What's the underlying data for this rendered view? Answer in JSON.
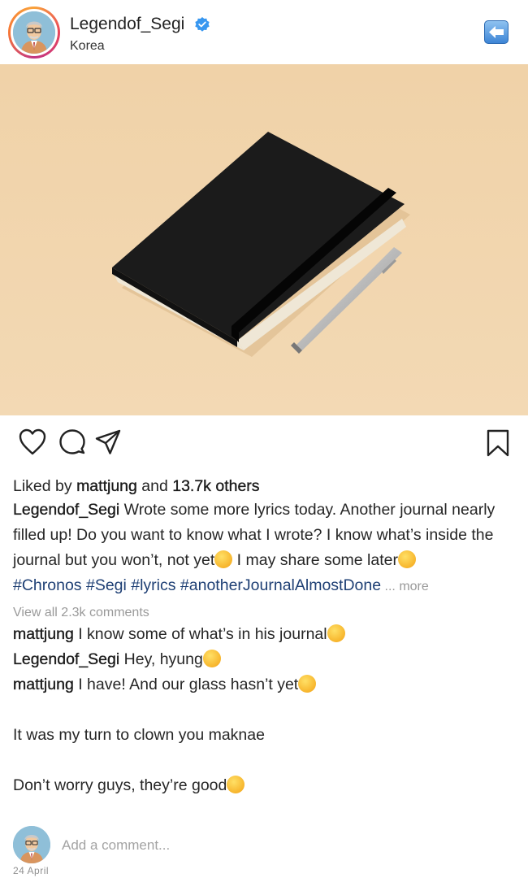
{
  "header": {
    "username": "Legendof_Segi",
    "location": "Korea"
  },
  "post": {
    "liked_prefix": "Liked by ",
    "liked_user": "mattjung",
    "liked_middle": " and ",
    "liked_count": "13.7k others",
    "caption_user": "Legendof_Segi",
    "caption_part1": " Wrote some more lyrics today. Another journal nearly filled up! Do you want to know what I wrote? I know what’s inside the journal but you won’t, not yet",
    "caption_part2": " I may share some later",
    "hashtags": "#Chronos #Segi #lyrics #anotherJournalAlmostDone",
    "more": " ... more",
    "view_all": "View all 2.3k comments"
  },
  "comments": [
    {
      "user": "mattjung",
      "text": " I know some of what’s in his journal"
    },
    {
      "user": "Legendof_Segi",
      "text": " Hey, hyung"
    },
    {
      "user": "mattjung",
      "text": " I have! And our glass hasn’t yet"
    }
  ],
  "extra_lines": [
    "It was my turn to clown you maknae",
    "Don’t worry guys, they’re good"
  ],
  "add_comment": {
    "placeholder": "Add a comment..."
  },
  "date": "24 April",
  "icons": {
    "like": "heart-icon",
    "comment": "comment-icon",
    "share": "send-icon",
    "save": "bookmark-icon",
    "back": "back-arrow-icon",
    "verified": "verified-badge-icon"
  }
}
